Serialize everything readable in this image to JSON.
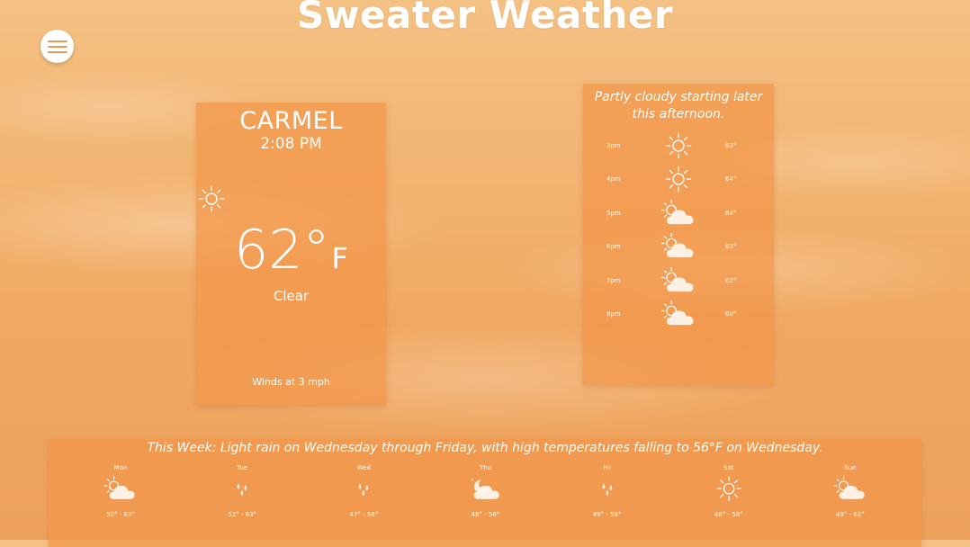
{
  "app": {
    "title": "Sweater Weather"
  },
  "current": {
    "city": "CARMEL",
    "time": "2:08 PM",
    "icon": "sun-icon",
    "temperature": "62°",
    "unit": "F",
    "condition": "Clear",
    "wind": "Winds at 3 mph"
  },
  "hourly": {
    "summary": "Partly cloudy starting later this afternoon.",
    "hours": [
      {
        "time": "3pm",
        "icon": "sun",
        "temp": "63°"
      },
      {
        "time": "4pm",
        "icon": "sun",
        "temp": "64°"
      },
      {
        "time": "5pm",
        "icon": "partly-cloudy",
        "temp": "64°"
      },
      {
        "time": "6pm",
        "icon": "partly-cloudy",
        "temp": "63°"
      },
      {
        "time": "7pm",
        "icon": "partly-cloudy",
        "temp": "62°"
      },
      {
        "time": "8pm",
        "icon": "partly-cloudy",
        "temp": "60°"
      }
    ]
  },
  "weekly": {
    "summary": "This Week: Light rain on Wednesday through Friday, with high temperatures falling to 56°F on Wednesday.",
    "days": [
      {
        "name": "Mon",
        "icon": "partly-cloudy",
        "range": "50° - 63°"
      },
      {
        "name": "Tue",
        "icon": "rain",
        "range": "52° - 63°"
      },
      {
        "name": "Wed",
        "icon": "rain",
        "range": "47° - 56°"
      },
      {
        "name": "Thu",
        "icon": "partly-cloudy-night",
        "range": "48° - 58°"
      },
      {
        "name": "Fri",
        "icon": "rain",
        "range": "49° - 58°"
      },
      {
        "name": "Sat",
        "icon": "sun",
        "range": "48° - 58°"
      },
      {
        "name": "Sun",
        "icon": "partly-cloudy",
        "range": "49° - 62°"
      }
    ]
  },
  "colors": {
    "card": "#f3964a",
    "background": "#f2b370",
    "icon": "#ffffff"
  }
}
